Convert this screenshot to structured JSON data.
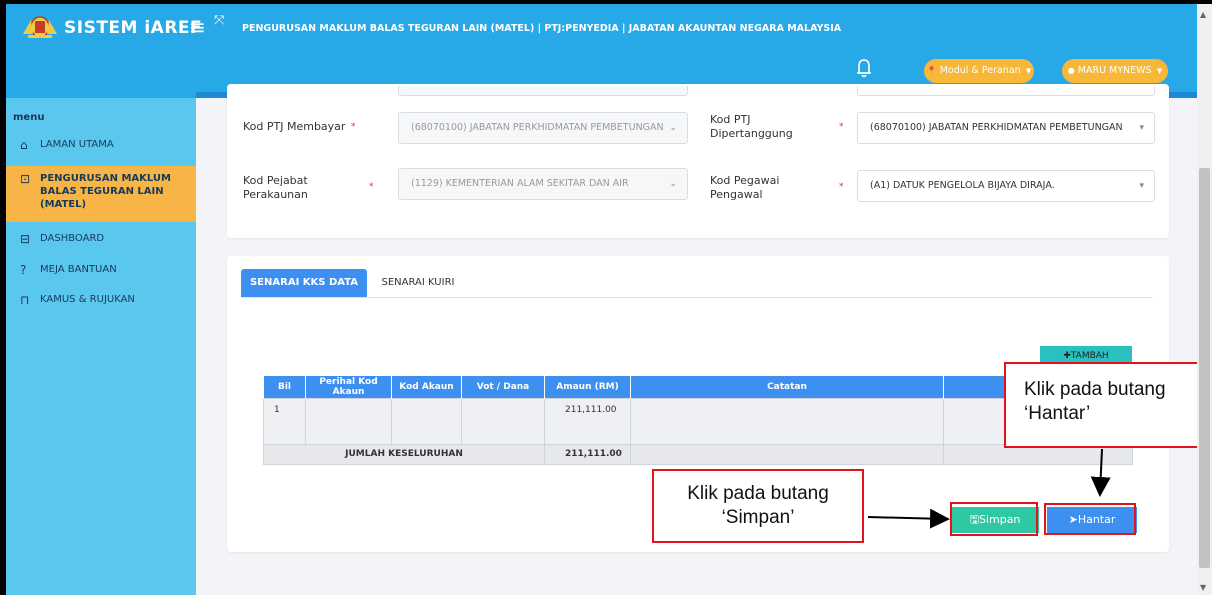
{
  "header": {
    "brand": "SISTEM iAREF",
    "menu_icon": "≡",
    "expand_icon": "⤧",
    "title": "PENGURUSAN MAKLUM BALAS TEGURAN LAIN (MATEL) | PTJ:PENYEDIA | JABATAN AKAUNTAN NEGARA MALAYSIA",
    "role_button": "Modul & Peranan",
    "user_button": "MARU MYNEWS",
    "role_icon": "📍",
    "user_icon": "👤",
    "colors": {
      "header": "#26a9e6",
      "pill": "#f7b839"
    }
  },
  "sidebar": {
    "heading": "menu",
    "items": [
      {
        "label": "LAMAN UTAMA",
        "icon": "home-icon",
        "glyph": "⌂"
      },
      {
        "label": "PENGURUSAN MAKLUM BALAS TEGURAN LAIN (MATEL)",
        "icon": "list-icon",
        "glyph": "⊡",
        "active": true
      },
      {
        "label": "DASHBOARD",
        "icon": "dashboard-icon",
        "glyph": "⊟"
      },
      {
        "label": "MEJA BANTUAN",
        "icon": "help-icon",
        "glyph": "?"
      },
      {
        "label": "KAMUS & RUJUKAN",
        "icon": "book-icon",
        "glyph": "⊓"
      }
    ]
  },
  "form": {
    "kod_ptj_membayar": {
      "label": "Kod PTJ Membayar",
      "value": "(68070100) JABATAN PERKHIDMATAN PEMBETUNGAN"
    },
    "kod_ptj_dipertanggung": {
      "label": "Kod PTJ Dipertanggung",
      "value": "(68070100) JABATAN PERKHIDMATAN PEMBETUNGAN"
    },
    "kod_pejabat_perakaunan": {
      "label": "Kod Pejabat Perakaunan",
      "value": "(1129) KEMENTERIAN ALAM SEKITAR DAN AIR"
    },
    "kod_pegawai_pengawal": {
      "label": "Kod Pegawai Pengawal",
      "value": "(A1) DATUK PENGELOLA BIJAYA DIRAJA."
    },
    "required_mark": "*"
  },
  "tabs": [
    {
      "label": "SENARAI KKS DATA",
      "active": true
    },
    {
      "label": "SENARAI KUIRI",
      "active": false
    }
  ],
  "table": {
    "add_button": "TAMBAH",
    "columns": [
      "Bil",
      "Perihal Kod Akaun",
      "Kod Akaun",
      "Vot / Dana",
      "Amaun (RM)",
      "Catatan",
      ""
    ],
    "rows": [
      {
        "bil": "1",
        "perihal": "",
        "kod_akaun": "",
        "vot": "",
        "amaun": "211,111.00",
        "catatan": ""
      }
    ],
    "total_label": "JUMLAH KESELURUHAN",
    "total_value": "211,111.00"
  },
  "actions": {
    "save": "Simpan",
    "submit": "Hantar"
  },
  "annotations": {
    "hantar": "Klik pada butang ‘Hantar’",
    "simpan": "Klik pada butang ‘Simpan’"
  }
}
